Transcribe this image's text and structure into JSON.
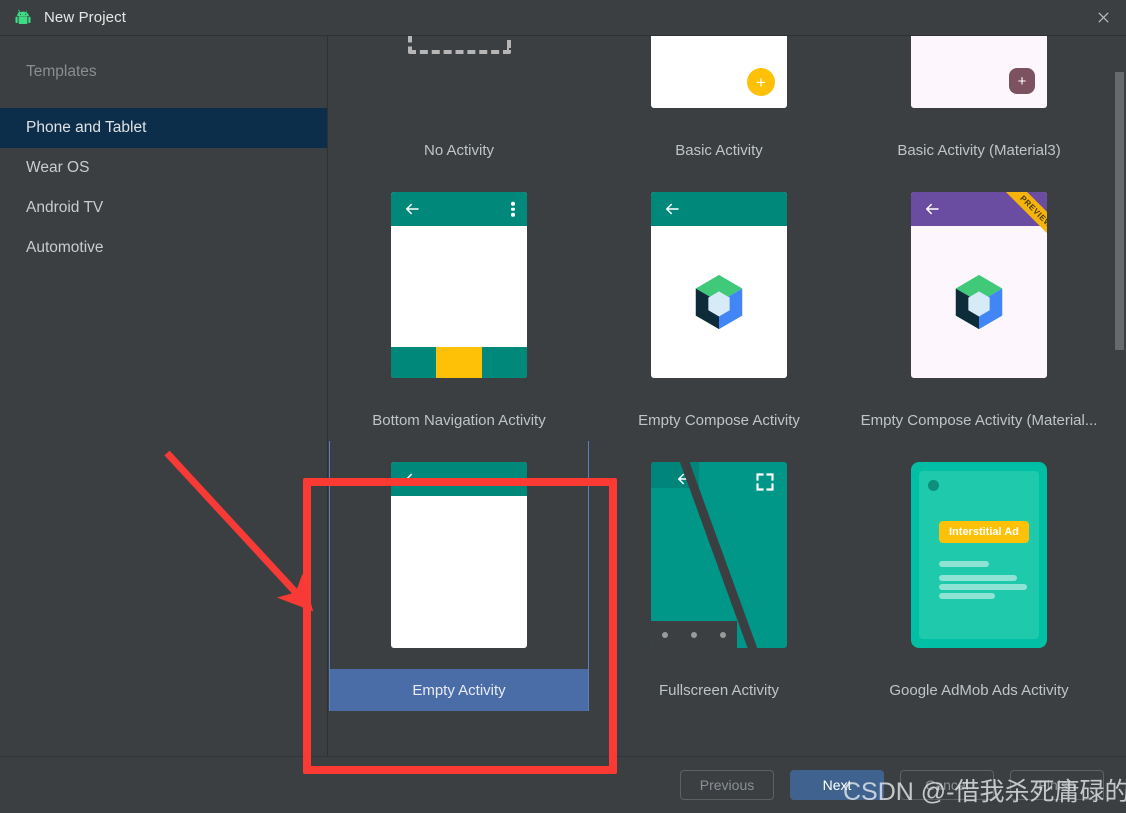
{
  "window": {
    "title": "New Project",
    "app_icon": "android-robot-icon",
    "close_icon": "close-icon"
  },
  "sidebar": {
    "header": "Templates",
    "items": [
      {
        "label": "Phone and Tablet",
        "selected": true
      },
      {
        "label": "Wear OS",
        "selected": false
      },
      {
        "label": "Android TV",
        "selected": false
      },
      {
        "label": "Automotive",
        "selected": false
      }
    ]
  },
  "templates": [
    {
      "label": "No Activity",
      "selected": false,
      "thumb": "dashed-outline-icon"
    },
    {
      "label": "Basic Activity",
      "selected": false,
      "thumb": "white-screen-yellow-fab",
      "fab_color": "#ffc107"
    },
    {
      "label": "Basic Activity (Material3)",
      "selected": false,
      "thumb": "white-screen-square-fab",
      "fab_color": "#7d5260"
    },
    {
      "label": "Bottom Navigation Activity",
      "selected": false,
      "thumb": "teal-appbar-bottom-nav",
      "appbar_color": "#00897b",
      "accent_color": "#ffc107"
    },
    {
      "label": "Empty Compose Activity",
      "selected": false,
      "thumb": "teal-appbar-compose-logo",
      "appbar_color": "#00897b"
    },
    {
      "label": "Empty Compose Activity (Material...",
      "selected": false,
      "thumb": "purple-appbar-compose-logo",
      "appbar_color": "#6a4ca0",
      "ribbon": "PREVIEW"
    },
    {
      "label": "Empty Activity",
      "selected": true,
      "thumb": "teal-appbar-blank-screen",
      "appbar_color": "#00897b"
    },
    {
      "label": "Fullscreen Activity",
      "selected": false,
      "thumb": "teal-fullscreen-screen",
      "appbar_color": "#009688"
    },
    {
      "label": "Google AdMob Ads Activity",
      "selected": false,
      "thumb": "admob-interstitial-screen",
      "chip_label": "Interstitial Ad",
      "chip_color": "#ffc107"
    }
  ],
  "footer": {
    "buttons": [
      {
        "label": "Previous",
        "primary": false,
        "enabled": false
      },
      {
        "label": "Next",
        "primary": true,
        "enabled": true
      },
      {
        "label": "Cancel",
        "primary": false,
        "enabled": true
      },
      {
        "label": "Finish",
        "primary": false,
        "enabled": false
      }
    ]
  },
  "annotations": {
    "watermark": "CSDN @-借我杀死庸碌的情怀-",
    "highlight_color": "#fc3a34",
    "arrow": "red-arrow-pointing-to-empty-activity"
  },
  "scrollbar": {
    "orientation": "vertical"
  }
}
